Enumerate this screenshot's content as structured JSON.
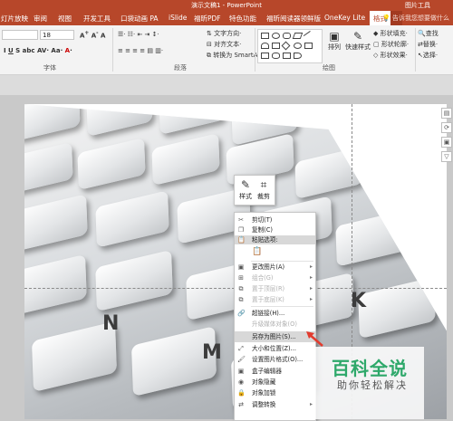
{
  "window": {
    "title": "演示文稿1 - PowerPoint",
    "context_tab_group": "图片工具"
  },
  "tabs": [
    {
      "label": "灯片放映"
    },
    {
      "label": "审阅"
    },
    {
      "label": "视图"
    },
    {
      "label": "开发工具"
    },
    {
      "label": "口袋动画 PA"
    },
    {
      "label": "iSlide"
    },
    {
      "label": "福昕PDF"
    },
    {
      "label": "特色功能"
    },
    {
      "label": "福昕阅读器领鲜版"
    },
    {
      "label": "OneKey Lite"
    },
    {
      "label": "格式"
    }
  ],
  "tell_me": "告诉我您想要做什么",
  "ribbon": {
    "font_size_value": "18",
    "font_group_label": "字体",
    "paragraph_group_label": "段落",
    "drawing_group_label": "绘图",
    "text_direction": "文字方向",
    "align_text": "对齐文本",
    "convert_smartart": "转换为 SmartArt",
    "arrange": "排列",
    "quick_styles": "快速样式",
    "shape_fill": "形状填充",
    "shape_outline": "形状轮廓",
    "shape_effects": "形状效果",
    "find": "查找",
    "replace": "替换",
    "select": "选择"
  },
  "keyboard_labels": [
    "N",
    "M",
    "K"
  ],
  "mini_toolbar": {
    "style_label": "样式",
    "crop_label": "裁剪"
  },
  "context_menu": {
    "items": [
      {
        "label": "剪切(T)",
        "icon": "scissors-icon",
        "disabled": false
      },
      {
        "label": "复制(C)",
        "icon": "copy-icon",
        "disabled": false
      },
      {
        "label": "粘贴选项:",
        "icon": "paste-icon",
        "disabled": false
      },
      {
        "label": "更改图片(A)",
        "icon": "change-picture-icon",
        "disabled": false,
        "arrow": true
      },
      {
        "label": "组合(G)",
        "icon": "group-icon",
        "disabled": true,
        "arrow": true
      },
      {
        "label": "置于顶层(R)",
        "icon": "bring-front-icon",
        "disabled": true,
        "arrow": true
      },
      {
        "label": "置于底层(K)",
        "icon": "send-back-icon",
        "disabled": true,
        "arrow": true
      },
      {
        "label": "超链接(H)...",
        "icon": "hyperlink-icon",
        "disabled": false
      },
      {
        "label": "升级媒体对象(O)",
        "icon": "",
        "disabled": true
      },
      {
        "label": "另存为图片(S)...",
        "icon": "",
        "disabled": false,
        "highlighted": true
      },
      {
        "label": "大小和位置(Z)...",
        "icon": "size-icon",
        "disabled": false
      },
      {
        "label": "设置图片格式(O)...",
        "icon": "format-picture-icon",
        "disabled": false
      },
      {
        "label": "盒子编辑器",
        "icon": "box-editor-icon",
        "disabled": false
      },
      {
        "label": "对象隐藏",
        "icon": "hide-icon",
        "disabled": false
      },
      {
        "label": "对象加锁",
        "icon": "lock-icon",
        "disabled": false
      },
      {
        "label": "调整转换",
        "icon": "convert-icon",
        "disabled": false,
        "arrow": true
      }
    ]
  },
  "watermark": {
    "title": "百科全说",
    "subtitle": "助你轻松解决"
  },
  "colors": {
    "ribbon_red": "#b7472a",
    "watermark_green": "#2ea86a",
    "arrow_red": "#e23b2e"
  }
}
